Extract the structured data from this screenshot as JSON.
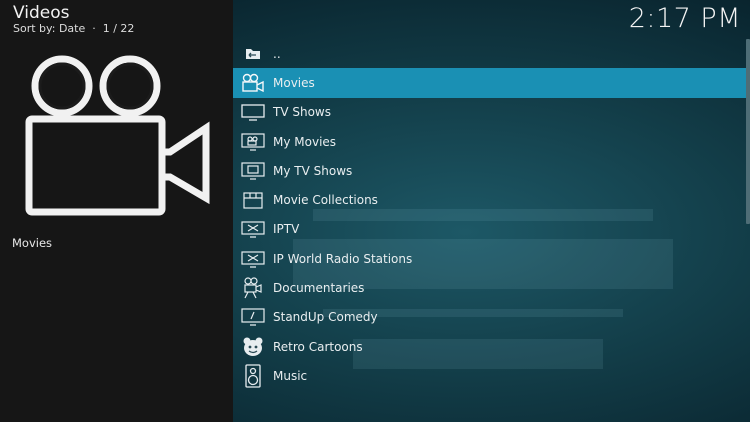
{
  "header": {
    "title": "Videos",
    "sort_label": "Sort by: Date",
    "position": "1 / 22",
    "subtitle": "Sort by: Date  ·  1 / 22"
  },
  "clock": {
    "time": "2:17 PM"
  },
  "info": {
    "selected_label": "Movies"
  },
  "colors": {
    "focus": "#1a90b4",
    "left_pane": "#161616",
    "background": "#123c47"
  },
  "list": {
    "items": [
      {
        "label": "..",
        "icon": "folder-back-icon",
        "focused": false
      },
      {
        "label": "Movies",
        "icon": "movie-camera-icon",
        "focused": true
      },
      {
        "label": "TV Shows",
        "icon": "tv-icon",
        "focused": false
      },
      {
        "label": "My Movies",
        "icon": "monitor-camera-icon",
        "focused": false
      },
      {
        "label": "My TV Shows",
        "icon": "monitor-tv-icon",
        "focused": false
      },
      {
        "label": "Movie Collections",
        "icon": "collection-box-icon",
        "focused": false
      },
      {
        "label": "IPTV",
        "icon": "iptv-icon",
        "focused": false
      },
      {
        "label": "IP World Radio Stations",
        "icon": "radio-icon",
        "focused": false
      },
      {
        "label": "Documentaries",
        "icon": "documentary-camera-icon",
        "focused": false
      },
      {
        "label": "StandUp Comedy",
        "icon": "comedy-monitor-icon",
        "focused": false
      },
      {
        "label": "Retro Cartoons",
        "icon": "cartoon-logo-icon",
        "focused": false
      },
      {
        "label": "Music",
        "icon": "speaker-icon",
        "focused": false
      }
    ]
  }
}
